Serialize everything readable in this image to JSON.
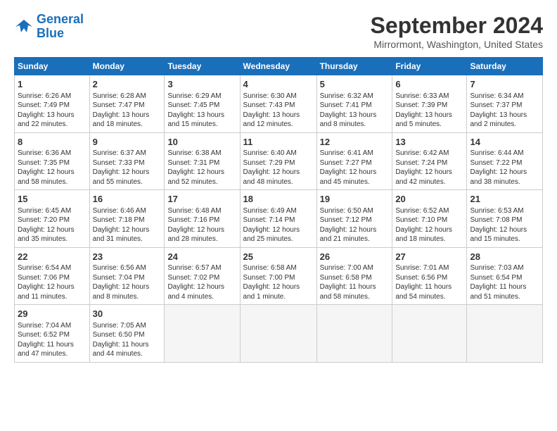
{
  "logo": {
    "line1": "General",
    "line2": "Blue"
  },
  "title": "September 2024",
  "location": "Mirrormont, Washington, United States",
  "days_of_week": [
    "Sunday",
    "Monday",
    "Tuesday",
    "Wednesday",
    "Thursday",
    "Friday",
    "Saturday"
  ],
  "weeks": [
    [
      {
        "day": 1,
        "lines": [
          "Sunrise: 6:26 AM",
          "Sunset: 7:49 PM",
          "Daylight: 13 hours",
          "and 22 minutes."
        ]
      },
      {
        "day": 2,
        "lines": [
          "Sunrise: 6:28 AM",
          "Sunset: 7:47 PM",
          "Daylight: 13 hours",
          "and 18 minutes."
        ]
      },
      {
        "day": 3,
        "lines": [
          "Sunrise: 6:29 AM",
          "Sunset: 7:45 PM",
          "Daylight: 13 hours",
          "and 15 minutes."
        ]
      },
      {
        "day": 4,
        "lines": [
          "Sunrise: 6:30 AM",
          "Sunset: 7:43 PM",
          "Daylight: 13 hours",
          "and 12 minutes."
        ]
      },
      {
        "day": 5,
        "lines": [
          "Sunrise: 6:32 AM",
          "Sunset: 7:41 PM",
          "Daylight: 13 hours",
          "and 8 minutes."
        ]
      },
      {
        "day": 6,
        "lines": [
          "Sunrise: 6:33 AM",
          "Sunset: 7:39 PM",
          "Daylight: 13 hours",
          "and 5 minutes."
        ]
      },
      {
        "day": 7,
        "lines": [
          "Sunrise: 6:34 AM",
          "Sunset: 7:37 PM",
          "Daylight: 13 hours",
          "and 2 minutes."
        ]
      }
    ],
    [
      {
        "day": 8,
        "lines": [
          "Sunrise: 6:36 AM",
          "Sunset: 7:35 PM",
          "Daylight: 12 hours",
          "and 58 minutes."
        ]
      },
      {
        "day": 9,
        "lines": [
          "Sunrise: 6:37 AM",
          "Sunset: 7:33 PM",
          "Daylight: 12 hours",
          "and 55 minutes."
        ]
      },
      {
        "day": 10,
        "lines": [
          "Sunrise: 6:38 AM",
          "Sunset: 7:31 PM",
          "Daylight: 12 hours",
          "and 52 minutes."
        ]
      },
      {
        "day": 11,
        "lines": [
          "Sunrise: 6:40 AM",
          "Sunset: 7:29 PM",
          "Daylight: 12 hours",
          "and 48 minutes."
        ]
      },
      {
        "day": 12,
        "lines": [
          "Sunrise: 6:41 AM",
          "Sunset: 7:27 PM",
          "Daylight: 12 hours",
          "and 45 minutes."
        ]
      },
      {
        "day": 13,
        "lines": [
          "Sunrise: 6:42 AM",
          "Sunset: 7:24 PM",
          "Daylight: 12 hours",
          "and 42 minutes."
        ]
      },
      {
        "day": 14,
        "lines": [
          "Sunrise: 6:44 AM",
          "Sunset: 7:22 PM",
          "Daylight: 12 hours",
          "and 38 minutes."
        ]
      }
    ],
    [
      {
        "day": 15,
        "lines": [
          "Sunrise: 6:45 AM",
          "Sunset: 7:20 PM",
          "Daylight: 12 hours",
          "and 35 minutes."
        ]
      },
      {
        "day": 16,
        "lines": [
          "Sunrise: 6:46 AM",
          "Sunset: 7:18 PM",
          "Daylight: 12 hours",
          "and 31 minutes."
        ]
      },
      {
        "day": 17,
        "lines": [
          "Sunrise: 6:48 AM",
          "Sunset: 7:16 PM",
          "Daylight: 12 hours",
          "and 28 minutes."
        ]
      },
      {
        "day": 18,
        "lines": [
          "Sunrise: 6:49 AM",
          "Sunset: 7:14 PM",
          "Daylight: 12 hours",
          "and 25 minutes."
        ]
      },
      {
        "day": 19,
        "lines": [
          "Sunrise: 6:50 AM",
          "Sunset: 7:12 PM",
          "Daylight: 12 hours",
          "and 21 minutes."
        ]
      },
      {
        "day": 20,
        "lines": [
          "Sunrise: 6:52 AM",
          "Sunset: 7:10 PM",
          "Daylight: 12 hours",
          "and 18 minutes."
        ]
      },
      {
        "day": 21,
        "lines": [
          "Sunrise: 6:53 AM",
          "Sunset: 7:08 PM",
          "Daylight: 12 hours",
          "and 15 minutes."
        ]
      }
    ],
    [
      {
        "day": 22,
        "lines": [
          "Sunrise: 6:54 AM",
          "Sunset: 7:06 PM",
          "Daylight: 12 hours",
          "and 11 minutes."
        ]
      },
      {
        "day": 23,
        "lines": [
          "Sunrise: 6:56 AM",
          "Sunset: 7:04 PM",
          "Daylight: 12 hours",
          "and 8 minutes."
        ]
      },
      {
        "day": 24,
        "lines": [
          "Sunrise: 6:57 AM",
          "Sunset: 7:02 PM",
          "Daylight: 12 hours",
          "and 4 minutes."
        ]
      },
      {
        "day": 25,
        "lines": [
          "Sunrise: 6:58 AM",
          "Sunset: 7:00 PM",
          "Daylight: 12 hours",
          "and 1 minute."
        ]
      },
      {
        "day": 26,
        "lines": [
          "Sunrise: 7:00 AM",
          "Sunset: 6:58 PM",
          "Daylight: 11 hours",
          "and 58 minutes."
        ]
      },
      {
        "day": 27,
        "lines": [
          "Sunrise: 7:01 AM",
          "Sunset: 6:56 PM",
          "Daylight: 11 hours",
          "and 54 minutes."
        ]
      },
      {
        "day": 28,
        "lines": [
          "Sunrise: 7:03 AM",
          "Sunset: 6:54 PM",
          "Daylight: 11 hours",
          "and 51 minutes."
        ]
      }
    ],
    [
      {
        "day": 29,
        "lines": [
          "Sunrise: 7:04 AM",
          "Sunset: 6:52 PM",
          "Daylight: 11 hours",
          "and 47 minutes."
        ]
      },
      {
        "day": 30,
        "lines": [
          "Sunrise: 7:05 AM",
          "Sunset: 6:50 PM",
          "Daylight: 11 hours",
          "and 44 minutes."
        ]
      },
      null,
      null,
      null,
      null,
      null
    ]
  ]
}
